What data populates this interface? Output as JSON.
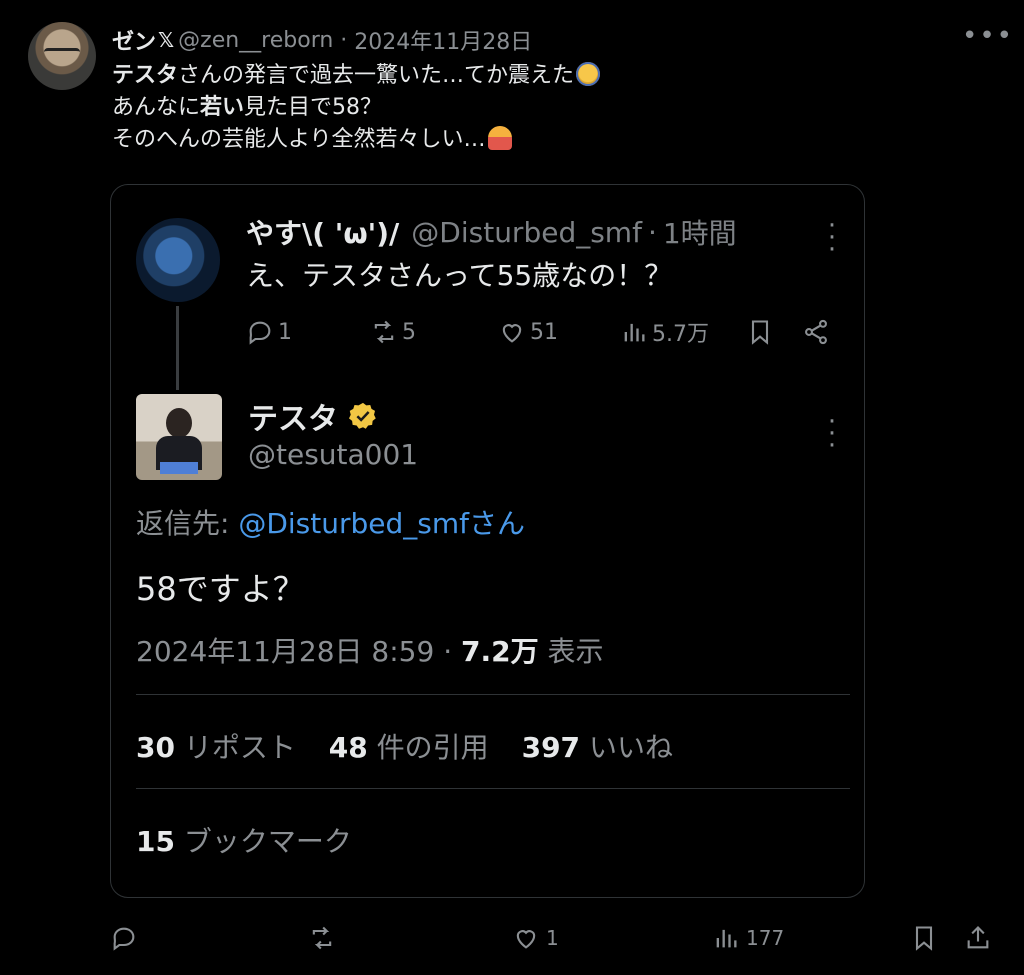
{
  "tweet": {
    "author": {
      "display_name": "ゼン",
      "handle": "@zen__reborn",
      "date": "2024年11月28日"
    },
    "text_line1_bold": "テスタ",
    "text_line1_rest": "さんの発言で過去一驚いた…てか震えた",
    "text_line2_pre": "あんなに",
    "text_line2_bold": "若い",
    "text_line2_post": "見た目で58？",
    "text_line3": "そのへんの芸能人より全然若々しい…",
    "actions": {
      "replies": "",
      "reposts": "",
      "likes": "1",
      "views": "177"
    }
  },
  "quoted_parent": {
    "name": "やす\\( 'ω')/",
    "handle": "@Disturbed_smf",
    "time": "1時間",
    "text": "え、テスタさんって55歳なの！？",
    "actions": {
      "replies": "1",
      "reposts": "5",
      "likes": "51",
      "views": "5.7万"
    }
  },
  "quoted_reply": {
    "name": "テスタ",
    "handle": "@tesuta001",
    "reply_to_label": "返信先: ",
    "reply_to_link": "@Disturbed_smfさん",
    "text": "58ですよ？",
    "timestamp": "2024年11月28日 8:59",
    "views_count": "7.2万",
    "views_label": "表示",
    "stats": {
      "reposts_count": "30",
      "reposts_label": "リポスト",
      "quotes_count": "48",
      "quotes_label": "件の引用",
      "likes_count": "397",
      "likes_label": "いいね"
    },
    "bookmarks_count": "15",
    "bookmarks_label": "ブックマーク"
  },
  "icons": [
    "x-logo-icon",
    "more-icon",
    "reply-icon",
    "repost-icon",
    "like-icon",
    "views-icon",
    "bookmark-icon",
    "share-icon",
    "upload-icon",
    "verified-badge-icon"
  ],
  "colors": {
    "background": "#000000",
    "text": "#e7e9ea",
    "muted": "#8b8f93",
    "link": "#4a99e9",
    "verified": "#f2c744",
    "border": "#2f3336"
  }
}
